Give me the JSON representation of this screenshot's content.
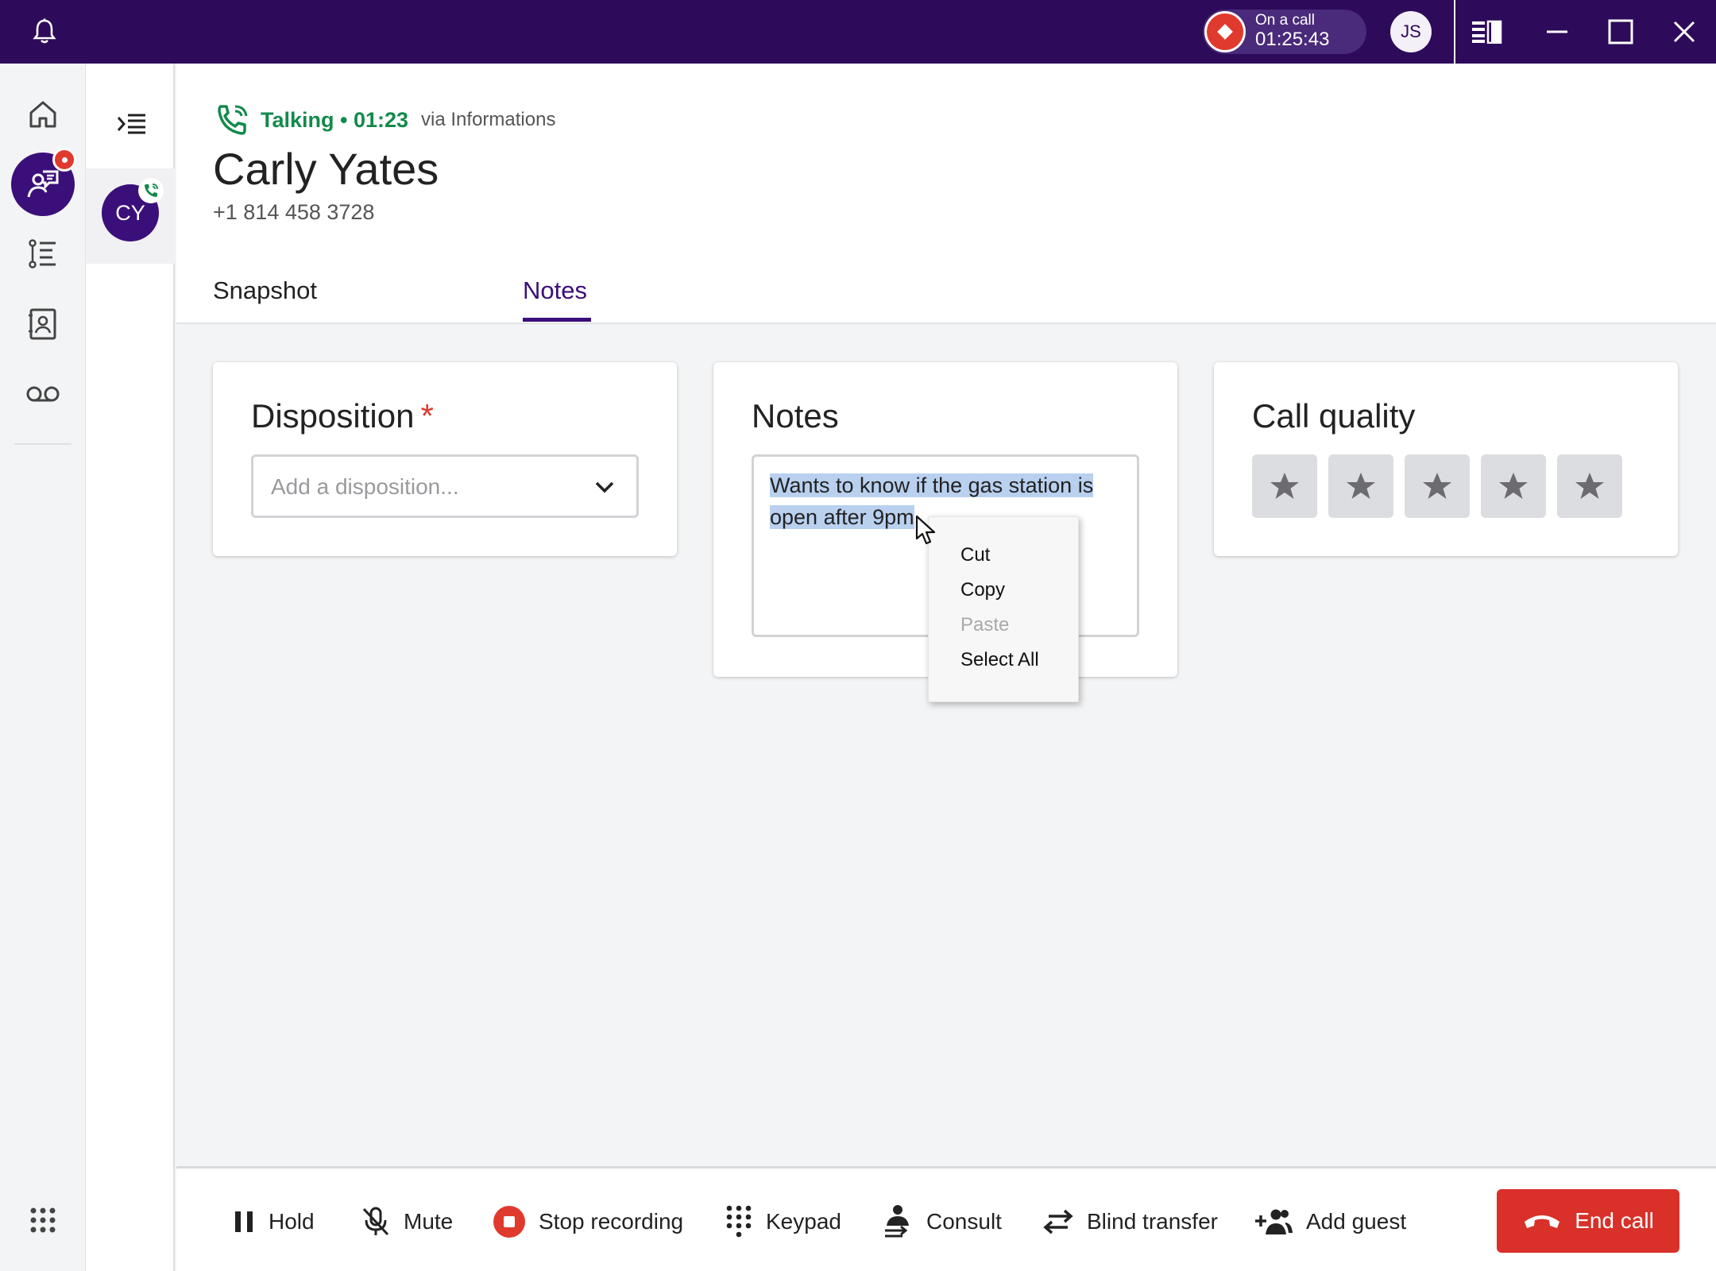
{
  "titlebar": {
    "on_call_label": "On a call",
    "on_call_time": "01:25:43",
    "user_initials": "JS"
  },
  "nav": {
    "items": [
      "home-icon",
      "interactions-icon",
      "queue-icon",
      "contacts-icon",
      "voicemail-icon"
    ],
    "apps_icon": "apps-grid-icon"
  },
  "interaction": {
    "initials": "CY"
  },
  "header": {
    "status": "Talking • 01:23",
    "via": "via Informations",
    "contact_name": "Carly Yates",
    "contact_phone": "+1 814 458 3728"
  },
  "tabs": [
    {
      "label": "Snapshot",
      "active": false
    },
    {
      "label": "Notes",
      "active": true
    }
  ],
  "cards": {
    "disposition": {
      "title": "Disposition",
      "required_mark": "*",
      "placeholder": "Add a disposition..."
    },
    "notes": {
      "title": "Notes",
      "text_line1": "Wants to know if the gas station is",
      "text_line2": "open after 9pm"
    },
    "call_quality": {
      "title": "Call quality",
      "stars_total": 5,
      "stars_selected": 0
    }
  },
  "context_menu": {
    "items": [
      {
        "label": "Cut",
        "enabled": true
      },
      {
        "label": "Copy",
        "enabled": true
      },
      {
        "label": "Paste",
        "enabled": false
      },
      {
        "label": "Select All",
        "enabled": true
      }
    ]
  },
  "toolbar": {
    "hold": "Hold",
    "mute": "Mute",
    "stop_recording": "Stop recording",
    "keypad": "Keypad",
    "consult": "Consult",
    "blind_transfer": "Blind transfer",
    "add_guest": "Add guest",
    "end_call": "End call"
  },
  "colors": {
    "brand": "#2d0a5a",
    "accent": "#3b0f7a",
    "talking": "#138a4b",
    "danger": "#d9302a"
  }
}
